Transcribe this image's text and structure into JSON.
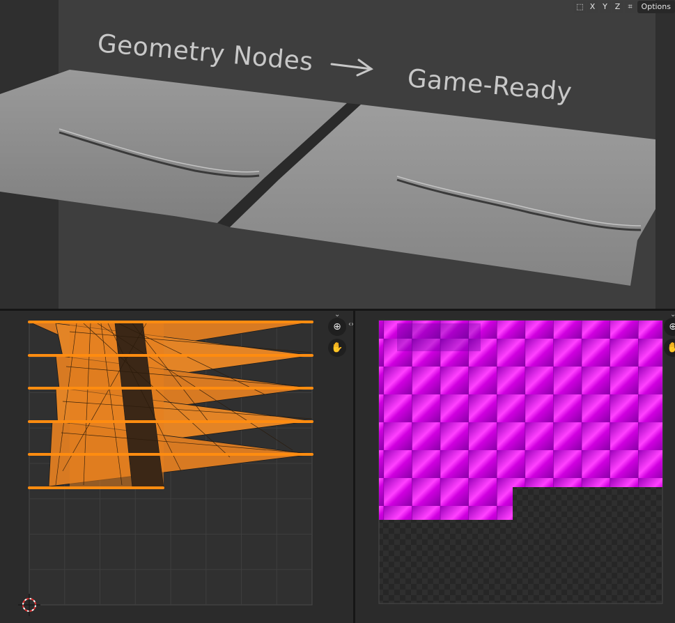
{
  "viewport": {
    "caption_left": "Geometry Nodes",
    "caption_right": "Game-Ready",
    "arrow_icon": "right-arrow-icon",
    "axis_buttons": [
      "X",
      "Y",
      "Z"
    ],
    "options_label": "Options",
    "colors": {
      "background": "#393939",
      "terrain": "#8e8e8e",
      "camera_frame": "#444444"
    }
  },
  "uv_editor": {
    "icons": [
      "zoom-icon",
      "hand-icon",
      "chevron-down-icon",
      "cursor-icon"
    ],
    "colors": {
      "uv_face": "#e8801e",
      "uv_edge": "#ff8c10",
      "grid": "#3c3c3c"
    }
  },
  "image_editor": {
    "icons": [
      "zoom-icon",
      "hand-icon",
      "chevron-down-icon"
    ],
    "colors": {
      "texture": "#c800d8",
      "checker_dark": "#262626",
      "checker_light": "#2e2e2e"
    }
  }
}
